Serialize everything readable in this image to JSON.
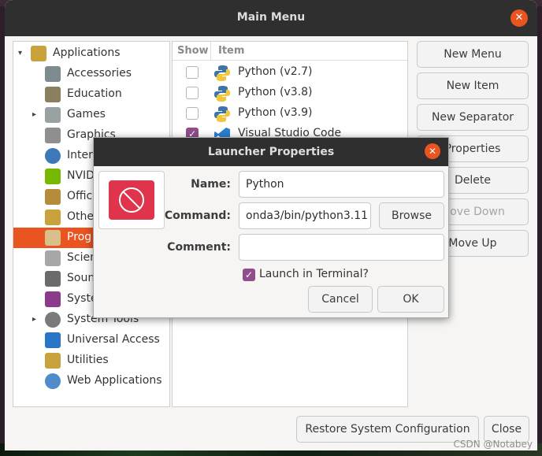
{
  "main_window": {
    "title": "Main Menu",
    "tree": {
      "items": [
        {
          "label": "Applications",
          "expander": "▾"
        },
        {
          "label": "Accessories"
        },
        {
          "label": "Education"
        },
        {
          "label": "Games",
          "expander": "▸"
        },
        {
          "label": "Graphics"
        },
        {
          "label": "Inter"
        },
        {
          "label": "NVID"
        },
        {
          "label": "Offic"
        },
        {
          "label": "Othe"
        },
        {
          "label": "Prog"
        },
        {
          "label": "Scien"
        },
        {
          "label": "Soun"
        },
        {
          "label": "Syste"
        },
        {
          "label": "System Tools",
          "expander": "▸"
        },
        {
          "label": "Universal Access"
        },
        {
          "label": "Utilities"
        },
        {
          "label": "Web Applications"
        }
      ]
    },
    "list": {
      "headers": {
        "show": "Show",
        "item": "Item"
      },
      "items": [
        {
          "label": "Python (v2.7)",
          "checked": false
        },
        {
          "label": "Python (v3.8)",
          "checked": false
        },
        {
          "label": "Python (v3.9)",
          "checked": false
        },
        {
          "label": "Visual Studio Code",
          "checked": true
        }
      ]
    },
    "buttons": {
      "new_menu": "New Menu",
      "new_item": "New Item",
      "new_separator": "New Separator",
      "properties": "Properties",
      "delete": "Delete",
      "move_down": "Move Down",
      "move_up": "Move Up",
      "restore": "Restore System Configuration",
      "close": "Close"
    }
  },
  "dialog": {
    "title": "Launcher Properties",
    "name_label": "Name:",
    "name_value": "Python",
    "command_label": "Command:",
    "command_value": "onda3/bin/python3.11",
    "browse": "Browse",
    "comment_label": "Comment:",
    "comment_value": "",
    "launch_in_terminal_label": "Launch in Terminal?",
    "launch_in_terminal": true,
    "cancel": "Cancel",
    "ok": "OK"
  },
  "watermark": "CSDN @Notabey",
  "colors": {
    "accent": "#e95420",
    "checkbox": "#924d8b",
    "titlebar": "#2f2f2f"
  }
}
